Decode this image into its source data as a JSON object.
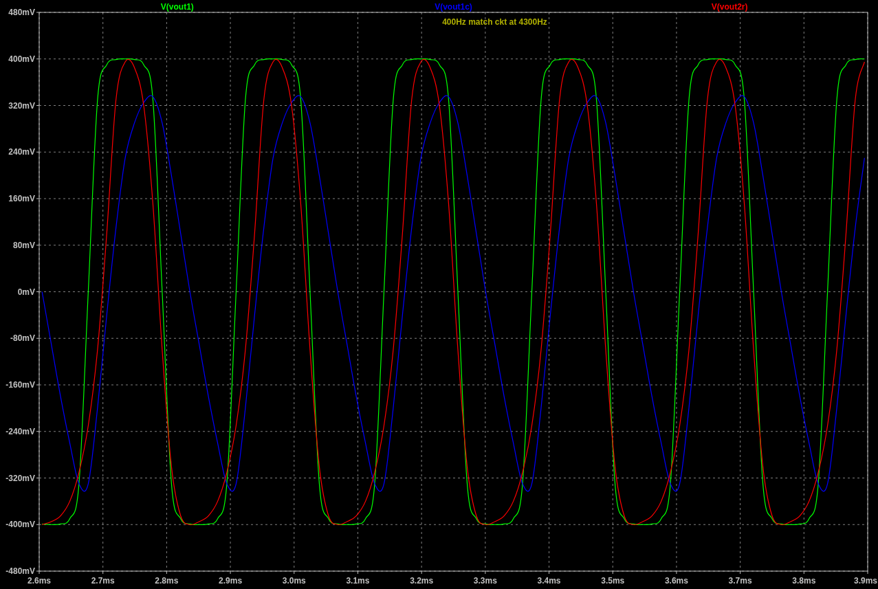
{
  "plot": {
    "chart_data": {
      "type": "line",
      "title": "400Hz match ckt at 4300Hz",
      "x": [
        2.6045,
        2.619,
        2.6335,
        2.648,
        2.6625,
        2.677,
        2.6915,
        2.706,
        2.7205,
        2.735,
        2.7495,
        2.764,
        2.7785,
        2.793,
        2.8075,
        2.822,
        2.8365,
        2.851,
        2.8655,
        2.88,
        2.8945,
        2.909,
        2.9235,
        2.938,
        2.9525,
        2.967,
        2.9815,
        2.996,
        3.0105,
        3.025,
        3.0395,
        3.054,
        3.0685,
        3.083,
        3.0975,
        3.112,
        3.1265,
        3.141,
        3.1555,
        3.17,
        3.1845,
        3.199,
        3.2135,
        3.228,
        3.2425,
        3.257,
        3.2715,
        3.286,
        3.3005,
        3.315,
        3.3295,
        3.344,
        3.3585,
        3.373,
        3.3875,
        3.402,
        3.4165,
        3.431,
        3.4455,
        3.46,
        3.4745,
        3.489,
        3.5035,
        3.518,
        3.5325,
        3.547,
        3.5615,
        3.576,
        3.5905,
        3.605,
        3.6195,
        3.634,
        3.6485,
        3.663,
        3.6775,
        3.692,
        3.7065,
        3.721,
        3.7355,
        3.75,
        3.7645,
        3.779,
        3.7935,
        3.808,
        3.8225,
        3.837,
        3.8515,
        3.866,
        3.8805,
        3.895
      ],
      "series": [
        {
          "name": "V(vout1)",
          "color": "#00ff00",
          "values": [
            -399,
            -400,
            -399,
            -390,
            -329,
            0,
            329,
            390,
            399,
            400,
            399,
            390,
            329,
            0,
            -329,
            -390,
            -399,
            -400,
            -399,
            -390,
            -329,
            0,
            329,
            390,
            399,
            400,
            399,
            390,
            329,
            0,
            -329,
            -390,
            -399,
            -400,
            -399,
            -390,
            -329,
            0,
            329,
            390,
            399,
            400,
            399,
            390,
            329,
            0,
            -329,
            -390,
            -399,
            -400,
            -399,
            -390,
            -329,
            0,
            329,
            390,
            399,
            400,
            399,
            390,
            329,
            0,
            -329,
            -390,
            -399,
            -400,
            -399,
            -390,
            -329,
            0,
            329,
            390,
            399,
            400,
            399,
            390,
            329,
            0,
            -329,
            -390,
            -399,
            -400,
            -399,
            -390,
            -329,
            0,
            329,
            390,
            399,
            400
          ]
        },
        {
          "name": "V(vout1c)",
          "color": "#0000ff",
          "values": [
            0,
            -90,
            -180,
            -260,
            -330,
            -330,
            -200,
            -40,
            110,
            230,
            290,
            325,
            335,
            290,
            200,
            100,
            0,
            -90,
            -180,
            -260,
            -330,
            -330,
            -200,
            -40,
            110,
            230,
            290,
            325,
            335,
            290,
            200,
            100,
            0,
            -90,
            -180,
            -260,
            -330,
            -330,
            -200,
            -40,
            110,
            230,
            290,
            325,
            335,
            290,
            200,
            100,
            0,
            -90,
            -180,
            -260,
            -330,
            -330,
            -200,
            -40,
            110,
            230,
            290,
            325,
            335,
            290,
            200,
            100,
            0,
            -90,
            -180,
            -260,
            -330,
            -330,
            -200,
            -40,
            110,
            230,
            290,
            325,
            335,
            290,
            200,
            100,
            0,
            -90,
            -180,
            -260,
            -330,
            -330,
            -200,
            -40,
            110,
            230
          ]
        },
        {
          "name": "V(vout2r)",
          "color": "#ff0000",
          "values": [
            -400,
            -395,
            -385,
            -360,
            -310,
            -230,
            -100,
            100,
            330,
            395,
            385,
            320,
            150,
            -100,
            -300,
            -385,
            -400,
            -395,
            -385,
            -360,
            -310,
            -230,
            -100,
            100,
            330,
            395,
            385,
            320,
            150,
            -100,
            -300,
            -385,
            -400,
            -395,
            -385,
            -360,
            -310,
            -230,
            -100,
            100,
            330,
            395,
            385,
            320,
            150,
            -100,
            -300,
            -385,
            -400,
            -395,
            -385,
            -360,
            -310,
            -230,
            -100,
            100,
            330,
            395,
            385,
            320,
            150,
            -100,
            -300,
            -385,
            -400,
            -395,
            -385,
            -360,
            -310,
            -230,
            -100,
            100,
            330,
            395,
            385,
            320,
            150,
            -100,
            -300,
            -385,
            -400,
            -395,
            -385,
            -360,
            -310,
            -230,
            -100,
            100,
            330,
            395
          ]
        }
      ],
      "grid": true,
      "xlim": [
        2.6,
        3.9
      ],
      "ylim": [
        -480,
        480
      ],
      "xticks": [
        {
          "value": 2.6,
          "label": "2.6ms"
        },
        {
          "value": 2.7,
          "label": "2.7ms"
        },
        {
          "value": 2.8,
          "label": "2.8ms"
        },
        {
          "value": 2.9,
          "label": "2.9ms"
        },
        {
          "value": 3.0,
          "label": "3.0ms"
        },
        {
          "value": 3.1,
          "label": "3.1ms"
        },
        {
          "value": 3.2,
          "label": "3.2ms"
        },
        {
          "value": 3.3,
          "label": "3.3ms"
        },
        {
          "value": 3.4,
          "label": "3.4ms"
        },
        {
          "value": 3.5,
          "label": "3.5ms"
        },
        {
          "value": 3.6,
          "label": "3.6ms"
        },
        {
          "value": 3.7,
          "label": "3.7ms"
        },
        {
          "value": 3.8,
          "label": "3.8ms"
        },
        {
          "value": 3.9,
          "label": "3.9ms"
        }
      ],
      "yticks": [
        {
          "value": 480,
          "label": "480mV"
        },
        {
          "value": 400,
          "label": "400mV"
        },
        {
          "value": 320,
          "label": "320mV"
        },
        {
          "value": 240,
          "label": "240mV"
        },
        {
          "value": 160,
          "label": "160mV"
        },
        {
          "value": 80,
          "label": "80mV"
        },
        {
          "value": 0,
          "label": "0mV"
        },
        {
          "value": -80,
          "label": "-80mV"
        },
        {
          "value": -160,
          "label": "-160mV"
        },
        {
          "value": -240,
          "label": "-240mV"
        },
        {
          "value": -320,
          "label": "-320mV"
        },
        {
          "value": -400,
          "label": "-400mV"
        },
        {
          "value": -480,
          "label": "-480mV"
        }
      ]
    }
  }
}
